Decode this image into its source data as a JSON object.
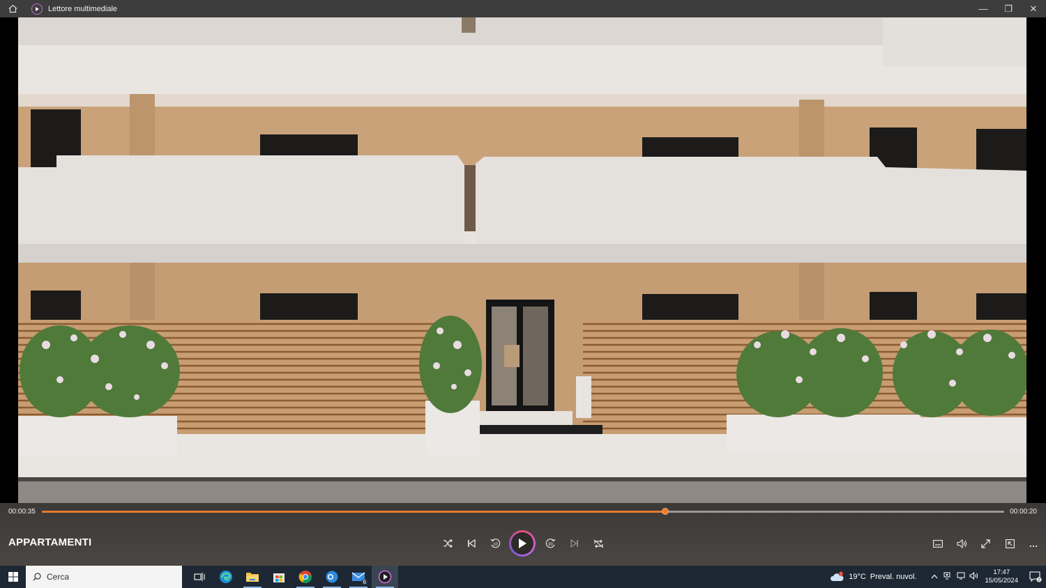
{
  "window": {
    "title": "Lettore multimediale",
    "controls": {
      "minimize": "—",
      "restore": "❐",
      "close": "✕"
    },
    "home_icon": "home-icon",
    "app_icon": "media-player-icon"
  },
  "player": {
    "time_elapsed": "00:00:35",
    "time_remaining": "00:00:20",
    "progress": 0.648,
    "media_title": "APPARTAMENTI",
    "accent": "#e07a2e",
    "buttons": {
      "shuffle": "shuffle-icon",
      "previous": "previous-icon",
      "skip_back": "10",
      "play": "play-icon",
      "skip_forward": "30",
      "next": "next-icon",
      "repeat": "repeat-icon",
      "subtitles": "subtitles-icon",
      "volume": "volume-icon",
      "fullscreen": "fullscreen-icon",
      "miniplayer": "miniplayer-icon",
      "more": "…"
    }
  },
  "taskbar": {
    "search_placeholder": "Cerca",
    "apps": [
      "task-view",
      "edge",
      "file-explorer",
      "microsoft-store",
      "chrome",
      "outlook",
      "mail",
      "media-player"
    ],
    "mail_badge": "6",
    "weather": {
      "temp": "19°C",
      "desc": "Preval. nuvol.",
      "alert": "1"
    },
    "clock": {
      "time": "17:47",
      "date": "15/05/2024"
    },
    "notifications": "2"
  }
}
